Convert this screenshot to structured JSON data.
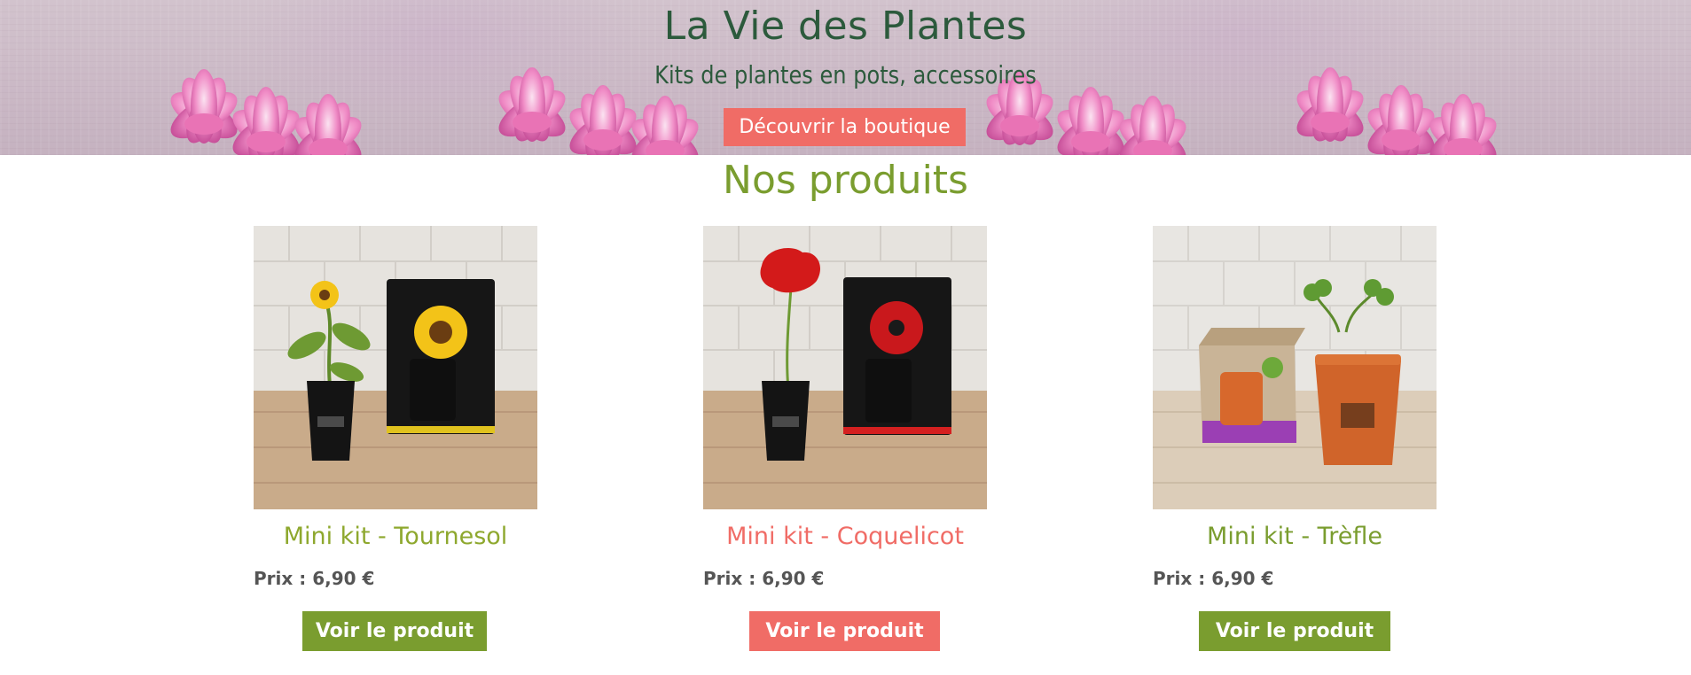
{
  "hero": {
    "title": "La Vie des Plantes",
    "subtitle": "Kits de plantes en pots, accessoires",
    "cta_label": "Découvrir la boutique"
  },
  "products_section": {
    "title": "Nos produits",
    "products": [
      {
        "name": "Mini kit - Tournesol",
        "price": "Prix : 6,90 €",
        "button_label": "Voir le produit",
        "name_color": "#8ea82e",
        "button_color": "#7a9d2f",
        "image_icon": "sunflower-kit-photo"
      },
      {
        "name": "Mini kit - Coquelicot",
        "price": "Prix : 6,90 €",
        "button_label": "Voir le produit",
        "name_color": "#f06c66",
        "button_color": "#f06c66",
        "image_icon": "poppy-kit-photo"
      },
      {
        "name": "Mini kit - Trèfle",
        "price": "Prix : 6,90 €",
        "button_label": "Voir le produit",
        "name_color": "#7a9d2f",
        "button_color": "#7a9d2f",
        "image_icon": "clover-kit-photo"
      }
    ]
  },
  "colors": {
    "title_green": "#2c5a3c",
    "accent_green": "#7a9d2f",
    "accent_coral": "#f06c66",
    "price_gray": "#555555"
  }
}
